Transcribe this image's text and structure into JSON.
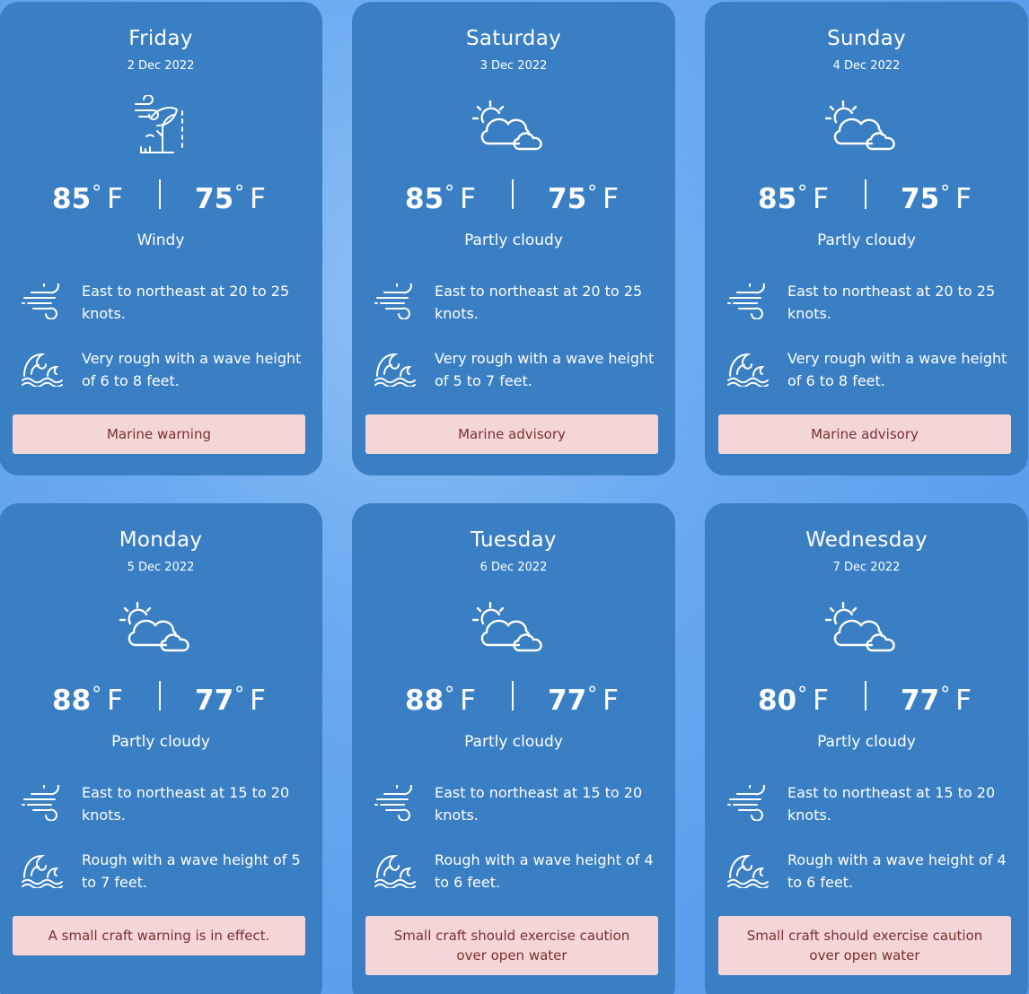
{
  "forecast": {
    "days": [
      {
        "day": "Friday",
        "date": "2 Dec 2022",
        "icon": "windy-icon",
        "high": "85",
        "low": "75",
        "deg": "°",
        "unit": "F",
        "condition": "Windy",
        "wind": "East to northeast at 20 to 25 knots.",
        "waves": "Very rough with a wave height of 6 to 8 feet.",
        "alert": "Marine warning"
      },
      {
        "day": "Saturday",
        "date": "3 Dec 2022",
        "icon": "partly-cloudy-icon",
        "high": "85",
        "low": "75",
        "deg": "°",
        "unit": "F",
        "condition": "Partly cloudy",
        "wind": "East to northeast at 20 to 25 knots.",
        "waves": "Very rough with a wave height of 5 to 7 feet.",
        "alert": "Marine advisory"
      },
      {
        "day": "Sunday",
        "date": "4 Dec 2022",
        "icon": "partly-cloudy-icon",
        "high": "85",
        "low": "75",
        "deg": "°",
        "unit": "F",
        "condition": "Partly cloudy",
        "wind": "East to northeast at 20 to 25 knots.",
        "waves": "Very rough with a wave height of 6 to 8 feet.",
        "alert": "Marine advisory"
      },
      {
        "day": "Monday",
        "date": "5 Dec 2022",
        "icon": "partly-cloudy-icon",
        "high": "88",
        "low": "77",
        "deg": "°",
        "unit": "F",
        "condition": "Partly cloudy",
        "wind": "East to northeast at 15 to 20 knots.",
        "waves": "Rough with a wave height of 5 to 7 feet.",
        "alert": "A small craft warning is in effect."
      },
      {
        "day": "Tuesday",
        "date": "6 Dec 2022",
        "icon": "partly-cloudy-icon",
        "high": "88",
        "low": "77",
        "deg": "°",
        "unit": "F",
        "condition": "Partly cloudy",
        "wind": "East to northeast at 15 to 20 knots.",
        "waves": "Rough with a wave height of 4 to 6 feet.",
        "alert": "Small craft should exercise caution over open water"
      },
      {
        "day": "Wednesday",
        "date": "7 Dec 2022",
        "icon": "partly-cloudy-icon",
        "high": "80",
        "low": "77",
        "deg": "°",
        "unit": "F",
        "condition": "Partly cloudy",
        "wind": "East to northeast at 15 to 20 knots.",
        "waves": "Rough with a wave height of 4 to 6 feet.",
        "alert": "Small craft should exercise caution over open water"
      }
    ]
  },
  "icons": {
    "wind": "wind-icon",
    "waves": "waves-icon"
  },
  "colors": {
    "background": "#5c9fee",
    "card": "#3a7ec3",
    "text": "#ffffff",
    "alert_bg": "#f5d6d8",
    "alert_text": "#7a2f2f"
  }
}
